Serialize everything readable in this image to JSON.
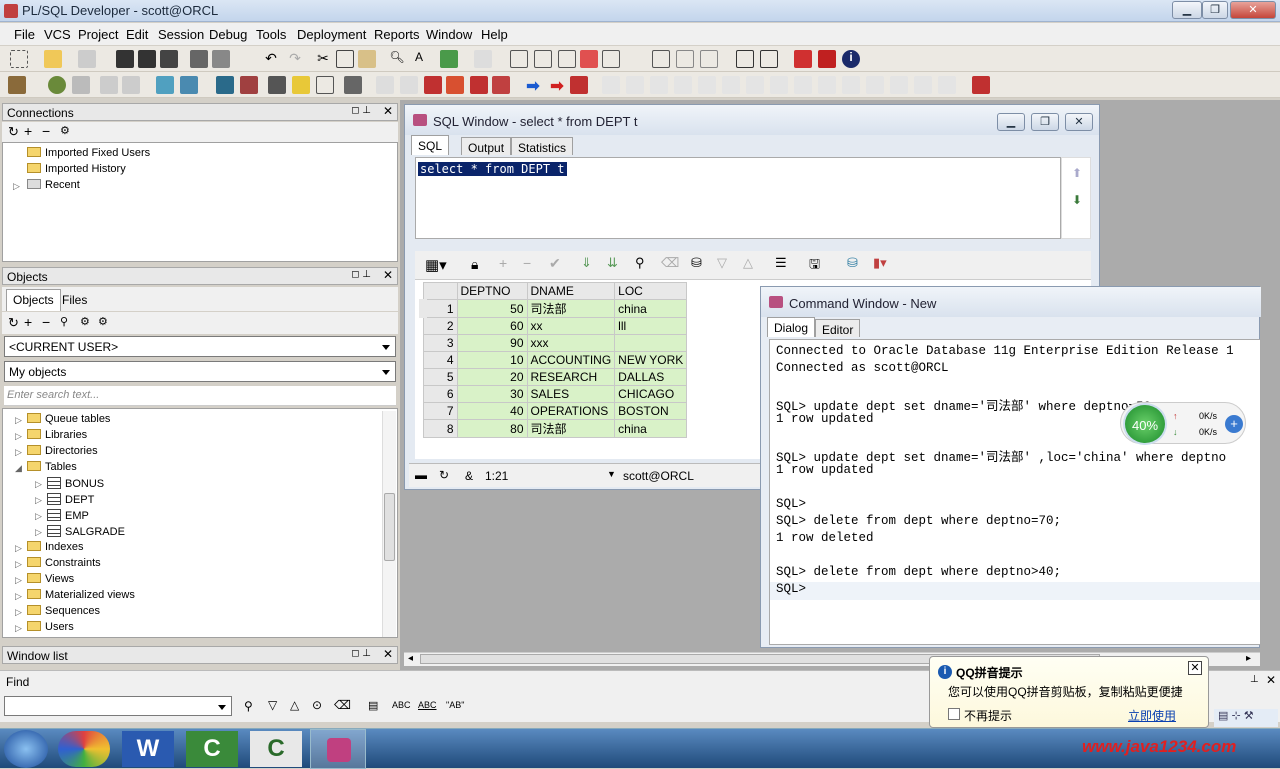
{
  "app": {
    "title": "PL/SQL Developer - scott@ORCL"
  },
  "menu": [
    "File",
    "VCS",
    "Project",
    "Edit",
    "Session",
    "Debug",
    "Tools",
    "Deployment",
    "Reports",
    "Window",
    "Help"
  ],
  "connections": {
    "title": "Connections",
    "items": [
      "Imported Fixed Users",
      "Imported History",
      "Recent"
    ]
  },
  "objects": {
    "title": "Objects",
    "tabs": [
      "Objects",
      "Files"
    ],
    "user_select": "<CURRENT USER>",
    "filter_select": "My objects",
    "search_placeholder": "Enter search text...",
    "tree": [
      {
        "label": "Queue tables",
        "level": 0,
        "type": "folder"
      },
      {
        "label": "Libraries",
        "level": 0,
        "type": "folder"
      },
      {
        "label": "Directories",
        "level": 0,
        "type": "folder"
      },
      {
        "label": "Tables",
        "level": 0,
        "type": "folder-open"
      },
      {
        "label": "BONUS",
        "level": 1,
        "type": "table"
      },
      {
        "label": "DEPT",
        "level": 1,
        "type": "table"
      },
      {
        "label": "EMP",
        "level": 1,
        "type": "table"
      },
      {
        "label": "SALGRADE",
        "level": 1,
        "type": "table"
      },
      {
        "label": "Indexes",
        "level": 0,
        "type": "folder"
      },
      {
        "label": "Constraints",
        "level": 0,
        "type": "folder"
      },
      {
        "label": "Views",
        "level": 0,
        "type": "folder"
      },
      {
        "label": "Materialized views",
        "level": 0,
        "type": "folder"
      },
      {
        "label": "Sequences",
        "level": 0,
        "type": "folder"
      },
      {
        "label": "Users",
        "level": 0,
        "type": "folder"
      }
    ]
  },
  "window_list": {
    "title": "Window list"
  },
  "find": {
    "title": "Find",
    "abc": "ABC",
    "abc2": "ABC",
    "ab": "\"AB\""
  },
  "sql_window": {
    "title": "SQL Window - select * from DEPT t",
    "tabs": [
      "SQL",
      "Output",
      "Statistics"
    ],
    "query": "select * from DEPT t",
    "columns": [
      "DEPTNO",
      "DNAME",
      "LOC"
    ],
    "rows": [
      [
        "1",
        "50",
        "司法部",
        "china"
      ],
      [
        "2",
        "60",
        "xx",
        "lll"
      ],
      [
        "3",
        "90",
        "xxx",
        ""
      ],
      [
        "4",
        "10",
        "ACCOUNTING",
        "NEW YORK"
      ],
      [
        "5",
        "20",
        "RESEARCH",
        "DALLAS"
      ],
      [
        "6",
        "30",
        "SALES",
        "CHICAGO"
      ],
      [
        "7",
        "40",
        "OPERATIONS",
        "BOSTON"
      ],
      [
        "8",
        "80",
        "司法部",
        "china"
      ]
    ],
    "status_pos": "1:21",
    "status_conn": "scott@ORCL"
  },
  "cmd_window": {
    "title": "Command Window - New",
    "tabs": [
      "Dialog",
      "Editor"
    ],
    "lines": [
      "Connected to Oracle Database 11g Enterprise Edition Release 1",
      "Connected as scott@ORCL",
      "",
      "SQL> update dept set dname='司法部' where deptno=50;",
      "1 row updated",
      "",
      "SQL> update dept set dname='司法部' ,loc='china' where deptno",
      "1 row updated",
      "",
      "SQL>",
      "SQL> delete from dept where deptno=70;",
      "1 row deleted",
      "",
      "SQL> delete from dept where deptno>40;",
      "SQL>"
    ]
  },
  "net_widget": {
    "percent": "40%",
    "up": "0K/s",
    "down": "0K/s"
  },
  "qq_popup": {
    "title": "QQ拼音提示",
    "message": "您可以使用QQ拼音剪贴板，复制粘贴更便捷",
    "checkbox": "不再提示",
    "link": "立即使用"
  },
  "watermark": "www.java1234.com",
  "colors": {
    "grid_row": "#d9f2c8",
    "selection": "#0a246a",
    "title_bg": "#c3d5ec"
  }
}
